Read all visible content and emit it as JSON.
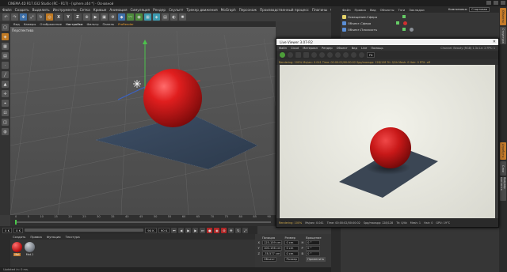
{
  "window": {
    "title": "CINEMA 4D R17.032 Studio (RC - R17) - [sphere.c4d *] - Основной"
  },
  "menubar": [
    "Файл",
    "Создать",
    "Выделить",
    "Инструменты",
    "Сетка",
    "Кривые",
    "Анимация",
    "Симуляция",
    "Рендер",
    "Скульпт",
    "Трекер движения",
    "MoGraph",
    "Персонаж",
    "Производственный процесс",
    "Плагины",
    "Скрипт",
    "Окно",
    "Справка"
  ],
  "toolbar": {
    "x_label": "X",
    "y_label": "Y",
    "z_label": "Z"
  },
  "viewport_menu": [
    "Вид",
    "Камеры",
    "Отображение",
    "Настройки",
    "Фильтр",
    "Панель",
    "ProRender"
  ],
  "viewport": {
    "label": "Перспектива"
  },
  "timeline_ticks": [
    "0",
    "5",
    "10",
    "15",
    "20",
    "25",
    "30",
    "35",
    "40",
    "45",
    "50",
    "55",
    "60",
    "65",
    "70",
    "75",
    "80",
    "85",
    "90"
  ],
  "transport": {
    "current_frame": "0 K",
    "start_frame": "0 K",
    "end_frame": "90 K",
    "range_end": "90 K"
  },
  "materials_menu": [
    "Создать",
    "Правка",
    "Функция",
    "Текстура"
  ],
  "materials": [
    {
      "name": "Mat",
      "color": "#d22a2a"
    },
    {
      "name": "Mat.1",
      "color": "#8a8f96"
    }
  ],
  "coords": {
    "headers": [
      "Позиция",
      "Размер",
      "Вращение"
    ],
    "rows": [
      {
        "axis": "X",
        "pos": "125.159 cm",
        "size": "0 cm",
        "rot_axis": "H",
        "rot": "0 °"
      },
      {
        "axis": "Y",
        "pos": "100.156 cm",
        "size": "0 cm",
        "rot_axis": "P",
        "rot": "0 °"
      },
      {
        "axis": "Z",
        "pos": "-78.577 cm",
        "size": "0 cm",
        "rot_axis": "B",
        "rot": "0 °"
      }
    ],
    "mode_select": "Объект",
    "size_select": "Размер",
    "apply_button": "Применить"
  },
  "status_bar": "Updated in: 0 ms.",
  "right_panel": {
    "tabs": [
      "Файл",
      "Правка",
      "Вид",
      "Объекты",
      "Тэги",
      "Закладки"
    ],
    "layout_label": "Компоновка:",
    "layout_value": "Стартовая",
    "objects": [
      "Освещение.Сфера",
      "Объект-Сфера",
      "Объект-Плоскость"
    ]
  },
  "right_edge_tabs": [
    "Объекты",
    "Структура",
    "Атрибуты",
    "Слои",
    "Браузер контента"
  ],
  "live_viewer": {
    "title": "Live Viewer 3.07-R2",
    "menu": [
      "Файл",
      "Cloud",
      "Материал",
      "Рендер",
      "Объект",
      "Вид",
      "Live",
      "Помощь"
    ],
    "info": "Channel: Beauty (RGB) 1.3x   Ln: 2   FPS: 1",
    "status_line": "Rendering: 100%  Ms/sec: 0.041  Time: 00:00:02/00:00:02  Spp/maxspp: 128/128  Tri: 0/1k  Mesh: 0  Hair: 0  RTX: off",
    "zoom": "Fit",
    "footer": {
      "rendering": "Rendering: 100%",
      "mesh": "Ms/sec: 0.041",
      "time": "Time: 00:00:02/00:00:02",
      "spp": "Spp/maxspp: 128/128",
      "tri": "Tri: 0/4k",
      "meshcount": "Mesh: 1",
      "hair": "Hair: 0",
      "gpu": "GPU: 19°C"
    }
  },
  "colors": {
    "accent": "#c37a2a",
    "sphere": "#d41c1c",
    "background": "#3a3a3a"
  }
}
